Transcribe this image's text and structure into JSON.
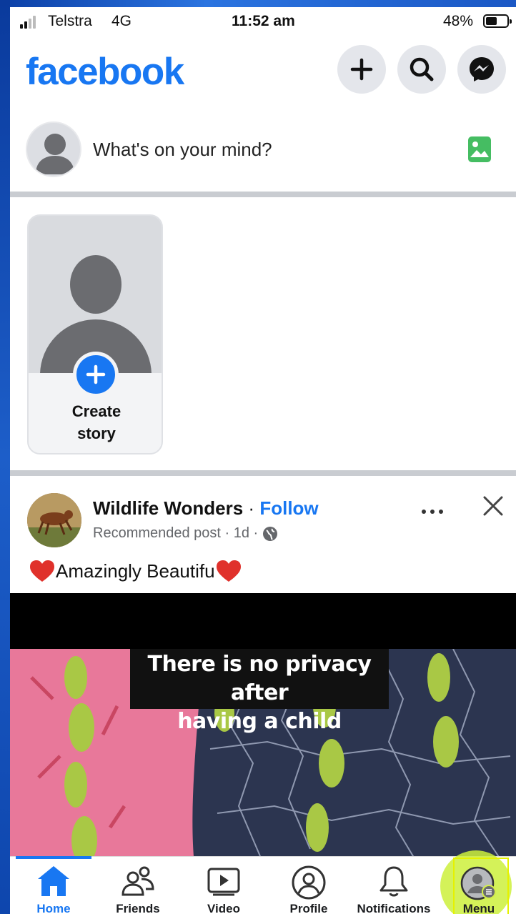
{
  "status_bar": {
    "carrier": "Telstra",
    "network": "4G",
    "time": "11:52 am",
    "battery": "48%",
    "battery_level": 0.48
  },
  "header": {
    "logo": "facebook",
    "icons": [
      "plus-icon",
      "search-icon",
      "messenger-icon"
    ]
  },
  "composer": {
    "placeholder": "What's on your mind?",
    "icon": "photo-icon"
  },
  "stories": {
    "create_label": "Create story"
  },
  "post": {
    "page_name": "Wildlife Wonders",
    "separator": "·",
    "follow_label": "Follow",
    "meta": "Recommended post · 1d ·",
    "caption": "Amazingly Beautifu",
    "video_caption_line1": "There is no privacy after",
    "video_caption_line2": "having a child"
  },
  "tabs": [
    {
      "label": "Home",
      "icon": "home-icon",
      "active": true
    },
    {
      "label": "Friends",
      "icon": "friends-icon",
      "active": false
    },
    {
      "label": "Video",
      "icon": "video-icon",
      "active": false
    },
    {
      "label": "Profile",
      "icon": "profile-icon",
      "active": false
    },
    {
      "label": "Notifications",
      "icon": "bell-icon",
      "active": false
    },
    {
      "label": "Menu",
      "icon": "menu-avatar-icon",
      "active": false
    }
  ],
  "colors": {
    "brand": "#1877f2",
    "highlight": "#cdf03c"
  }
}
